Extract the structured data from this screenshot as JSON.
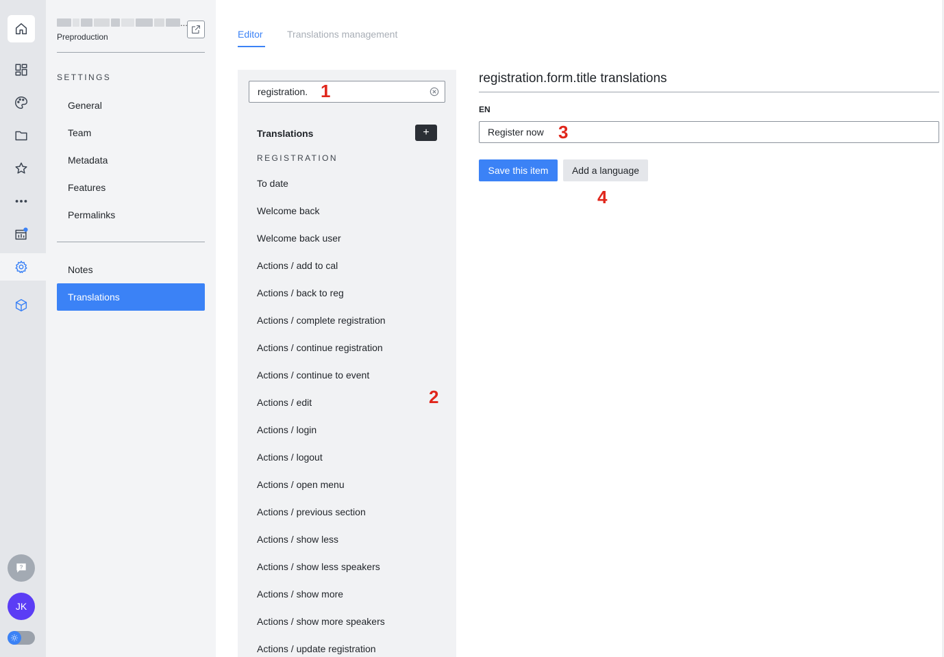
{
  "rail": {
    "icons": [
      "home-icon",
      "dashboard-icon",
      "palette-icon",
      "folder-icon",
      "star-icon",
      "more-icon",
      "analytics-icon",
      "settings-icon",
      "cube-icon"
    ],
    "avatar_initials": "JK",
    "accent": "#3b82f6"
  },
  "project": {
    "environment": "Preproduction",
    "name_ellipsis": "..."
  },
  "settings": {
    "section_title": "SETTINGS",
    "items": [
      {
        "label": "General"
      },
      {
        "label": "Team"
      },
      {
        "label": "Metadata"
      },
      {
        "label": "Features"
      },
      {
        "label": "Permalinks"
      },
      {
        "label": "Notes"
      },
      {
        "label": "Translations"
      }
    ],
    "selected": "Translations"
  },
  "tabs": [
    {
      "label": "Editor",
      "active": true
    },
    {
      "label": "Translations management",
      "active": false
    }
  ],
  "list": {
    "search_value": "registration.",
    "header": "Translations",
    "add_label": "+",
    "group_title": "REGISTRATION",
    "items": [
      "To date",
      "Welcome back",
      "Welcome back user",
      "Actions / add to cal",
      "Actions / back to reg",
      "Actions / complete registration",
      "Actions / continue registration",
      "Actions / continue to event",
      "Actions / edit",
      "Actions / login",
      "Actions / logout",
      "Actions / open menu",
      "Actions / previous section",
      "Actions / show less",
      "Actions / show less speakers",
      "Actions / show more",
      "Actions / show more speakers",
      "Actions / update registration"
    ]
  },
  "editor": {
    "title": "registration.form.title translations",
    "language_label": "EN",
    "value": "Register now",
    "save_label": "Save this item",
    "add_language_label": "Add a language"
  },
  "markers": [
    "1",
    "2",
    "3",
    "4"
  ]
}
